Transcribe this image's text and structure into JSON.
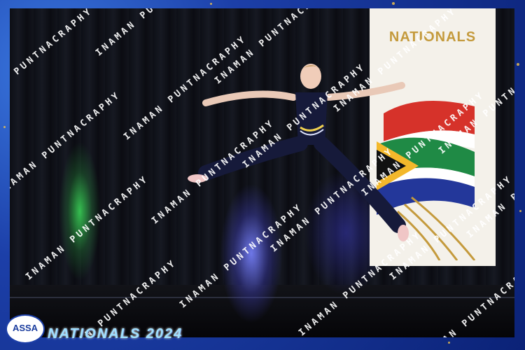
{
  "banner": {
    "title": "NATIONALS"
  },
  "watermark": {
    "text": "INAMAN PUNTNACRAPHY"
  },
  "logo": {
    "text": "ASSA"
  },
  "event": {
    "title": "NATIONALS 2024"
  },
  "colors": {
    "frame": "#1c3fa8",
    "gold": "#c49a3c",
    "event_title": "#9fe0ff"
  }
}
